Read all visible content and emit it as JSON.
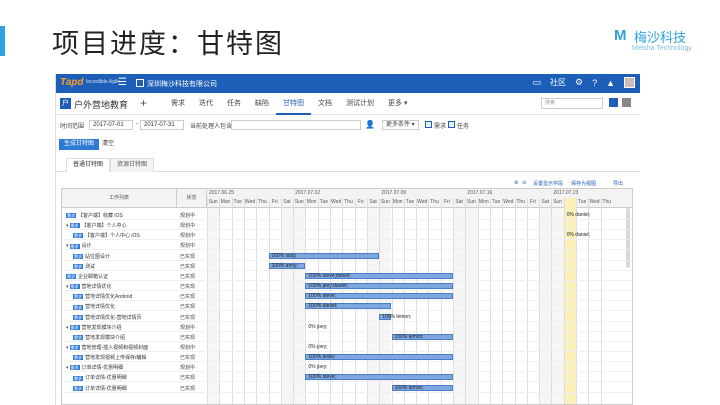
{
  "slide": {
    "title": "项目进度：甘特图",
    "accent_color": "#2ea3dc",
    "logo": {
      "mark": "M",
      "cn": "梅沙科技",
      "en": "Meisha Technology"
    }
  },
  "topbar": {
    "brand": "Tapd",
    "brand_sub": "Incredible Agile",
    "company": "深圳梅沙科技有限公司",
    "community": "社区",
    "icons": [
      "menu-icon",
      "chat-icon",
      "gear-icon",
      "help-icon",
      "bell-icon",
      "avatar"
    ]
  },
  "navbar": {
    "project": "户外营地教育",
    "plus": "+",
    "items": [
      {
        "label": "需求",
        "active": false
      },
      {
        "label": "迭代",
        "active": false
      },
      {
        "label": "任务",
        "active": false
      },
      {
        "label": "缺陷",
        "active": false
      },
      {
        "label": "甘特图",
        "active": true
      },
      {
        "label": "文档",
        "active": false
      },
      {
        "label": "测试计划",
        "active": false
      },
      {
        "label": "更多 ▾",
        "active": false
      }
    ],
    "search_placeholder": "搜索"
  },
  "filters": {
    "time_range_label": "时间范围",
    "start_date": "2017-07-01",
    "separator": "-",
    "end_date": "2017-07-31",
    "assignee_label": "当前处理人包含",
    "more_conditions": "更多条件",
    "check_requirement": "需求",
    "check_task": "任务"
  },
  "buttons": {
    "generate": "生成甘特图",
    "clear": "清空"
  },
  "tabs": [
    {
      "label": "普通甘特图",
      "active": true
    },
    {
      "label": "资源甘特图",
      "active": false
    }
  ],
  "gantt_tools": {
    "zoom_in": "放大",
    "zoom_out": "缩小",
    "set_fields": "设置显示字段",
    "save_view": "保存为视图",
    "export": "导出"
  },
  "gantt": {
    "header_list": "工作列表",
    "header_status": "状态",
    "weeks": [
      "2017.06.25",
      "2017.07.02",
      "2017.07.09",
      "2017.07.16",
      "2017.07.23"
    ],
    "days": [
      "Sun",
      "Mon",
      "Tue",
      "Wed",
      "Thu",
      "Fri",
      "Sat",
      "Sun",
      "Mon",
      "Tue",
      "Wed",
      "Thu",
      "Fri",
      "Sat",
      "Sun",
      "Mon",
      "Tue",
      "Wed",
      "Thu",
      "Fri",
      "Sat",
      "Sun",
      "Mon",
      "Tue",
      "Wed",
      "Thu",
      "Fri",
      "Sat",
      "Sun",
      "Today",
      "Tue",
      "Wed",
      "Thu"
    ],
    "rows": [
      {
        "indent": 0,
        "arrow": "",
        "tag": "需求",
        "bug": false,
        "name": "【客户端】收藏 iOS",
        "status": "规划中",
        "bar": null,
        "label": "0%  daniel;",
        "label_day": 29
      },
      {
        "indent": 0,
        "arrow": "▾",
        "tag": "需求",
        "bug": false,
        "name": "【客户端】个人中心",
        "status": "规划中",
        "bar": null,
        "label": "",
        "label_day": null
      },
      {
        "indent": 1,
        "arrow": "",
        "tag": "需求",
        "bug": false,
        "name": "【客户端】个人中心 iOS",
        "status": "规划中",
        "bar": null,
        "label": "0%  daniel;",
        "label_day": 29
      },
      {
        "indent": 0,
        "arrow": "▾",
        "tag": "需求",
        "bug": false,
        "name": "设计",
        "status": "规划中",
        "bar": null,
        "label": "",
        "label_day": null
      },
      {
        "indent": 1,
        "arrow": "",
        "tag": "需求",
        "bug": false,
        "name": "站位图设计",
        "status": "已实现",
        "bar": [
          5,
          14
        ],
        "label": "100%  xiaq;",
        "label_day": 5
      },
      {
        "indent": 1,
        "arrow": "",
        "tag": "需求",
        "bug": false,
        "name": "测试",
        "status": "已实现",
        "bar": [
          5,
          8
        ],
        "label": "100%  anny;",
        "label_day": 5
      },
      {
        "indent": 0,
        "arrow": "",
        "tag": "需求",
        "bug": false,
        "name": "企业邮箱认证",
        "status": "已实现",
        "bar": [
          8,
          20
        ],
        "label": "100%  steve;daniel;",
        "label_day": 8
      },
      {
        "indent": 0,
        "arrow": "▾",
        "tag": "需求",
        "bug": false,
        "name": "营地详情优化",
        "status": "已实现",
        "bar": [
          8,
          20
        ],
        "label": "100%  joey;daniel;",
        "label_day": 8
      },
      {
        "indent": 1,
        "arrow": "",
        "tag": "需求",
        "bug": false,
        "name": "营地详情优化Android",
        "status": "已实现",
        "bar": [
          8,
          20
        ],
        "label": "100%  steve;",
        "label_day": 8
      },
      {
        "indent": 1,
        "arrow": "",
        "tag": "需求",
        "bug": false,
        "name": "营地详情优化",
        "status": "已实现",
        "bar": [
          8,
          15
        ],
        "label": "100%  daniel;",
        "label_day": 8
      },
      {
        "indent": 1,
        "arrow": "",
        "tag": "需求",
        "bug": false,
        "name": "营地详情优化-营地详情页",
        "status": "已实现",
        "bar": [
          14,
          15
        ],
        "label": "100%  lemon;",
        "label_day": 14
      },
      {
        "indent": 0,
        "arrow": "▾",
        "tag": "需求",
        "bug": false,
        "name": "营地发现模块介绍",
        "status": "规划中",
        "bar": null,
        "label": "0%  joey;",
        "label_day": 8
      },
      {
        "indent": 1,
        "arrow": "",
        "tag": "需求",
        "bug": false,
        "name": "营地发现模块介绍",
        "status": "已实现",
        "bar": [
          15,
          20
        ],
        "label": "100%  lemon;",
        "label_day": 15
      },
      {
        "indent": 0,
        "arrow": "▾",
        "tag": "需求",
        "bug": false,
        "name": "营地管理-插入视频和视频封面",
        "status": "规划中",
        "bar": null,
        "label": "0%  joey;",
        "label_day": 8
      },
      {
        "indent": 1,
        "arrow": "",
        "tag": "需求",
        "bug": false,
        "name": "营地发现视频上传保存/编辑",
        "status": "已实现",
        "bar": [
          8,
          20
        ],
        "label": "100%  leslie;",
        "label_day": 8
      },
      {
        "indent": 0,
        "arrow": "▾",
        "tag": "需求",
        "bug": false,
        "name": "订单详情-优惠明细",
        "status": "规划中",
        "bar": null,
        "label": "0%  joey;",
        "label_day": 8
      },
      {
        "indent": 1,
        "arrow": "",
        "tag": "需求",
        "bug": false,
        "name": "订单详情-优惠明细",
        "status": "已实现",
        "bar": [
          8,
          20
        ],
        "label": "100%  steve;",
        "label_day": 8
      },
      {
        "indent": 1,
        "arrow": "",
        "tag": "需求",
        "bug": false,
        "name": "订单详情-优惠明细",
        "status": "已实现",
        "bar": [
          15,
          20
        ],
        "label": "100%  lemon;",
        "label_day": 15
      }
    ]
  }
}
